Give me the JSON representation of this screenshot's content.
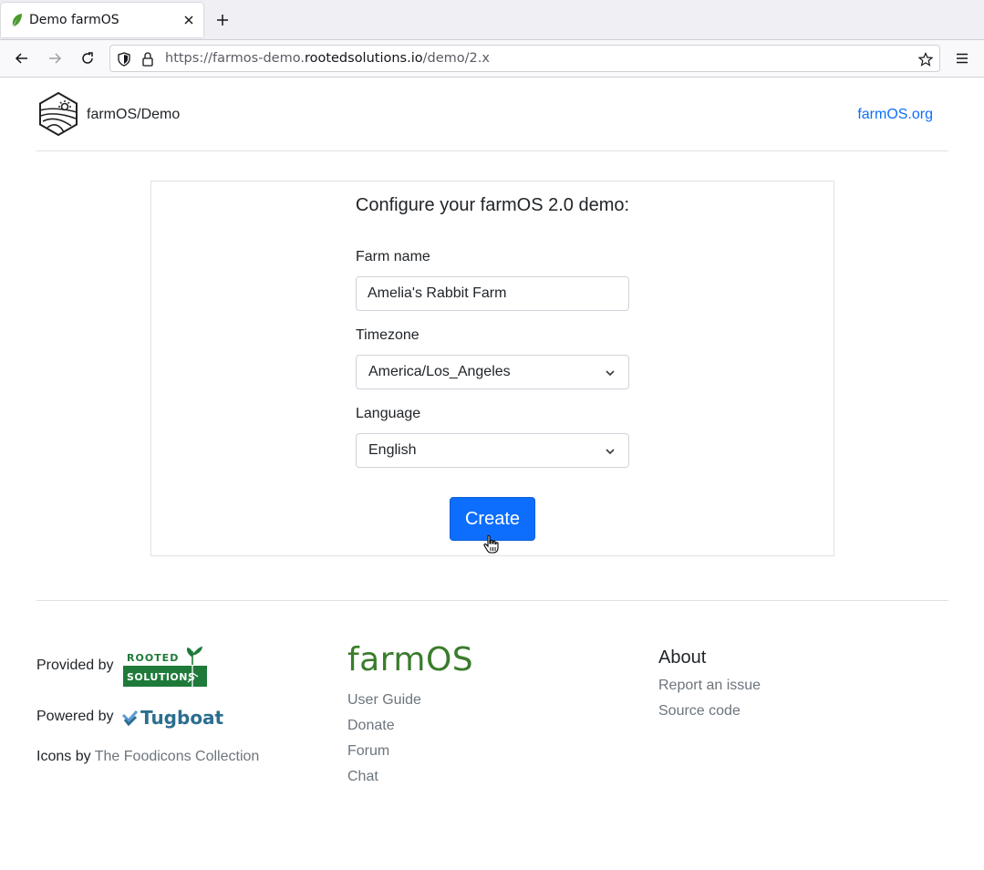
{
  "browser": {
    "tab_title": "Demo farmOS",
    "url_prefix": "https://farmos-demo.",
    "url_host": "rootedsolutions.io",
    "url_path": "/demo/2.x"
  },
  "header": {
    "brand": "farmOS/Demo",
    "link": "farmOS.org"
  },
  "form": {
    "title": "Configure your farmOS 2.0 demo:",
    "farm_name_label": "Farm name",
    "farm_name_value": "Amelia's Rabbit Farm",
    "timezone_label": "Timezone",
    "timezone_value": "America/Los_Angeles",
    "language_label": "Language",
    "language_value": "English",
    "submit_label": "Create"
  },
  "footer": {
    "provided_by": "Provided by",
    "rooted_line1": "ROOTED",
    "rooted_line2": "SOLUTIONS",
    "powered_by": "Powered by",
    "tugboat": "Tugboat",
    "icons_by": "Icons by",
    "icons_link": "The Foodicons Collection",
    "farmos_logo": "farmOS",
    "links": [
      "User Guide",
      "Donate",
      "Forum",
      "Chat"
    ],
    "about_heading": "About",
    "about_links": [
      "Report an issue",
      "Source code"
    ]
  },
  "colors": {
    "primary": "#0d6efd",
    "farmos_green": "#3a7c2c",
    "rooted_green": "#1f7a3a",
    "tugboat_blue": "#2c6e8f"
  }
}
